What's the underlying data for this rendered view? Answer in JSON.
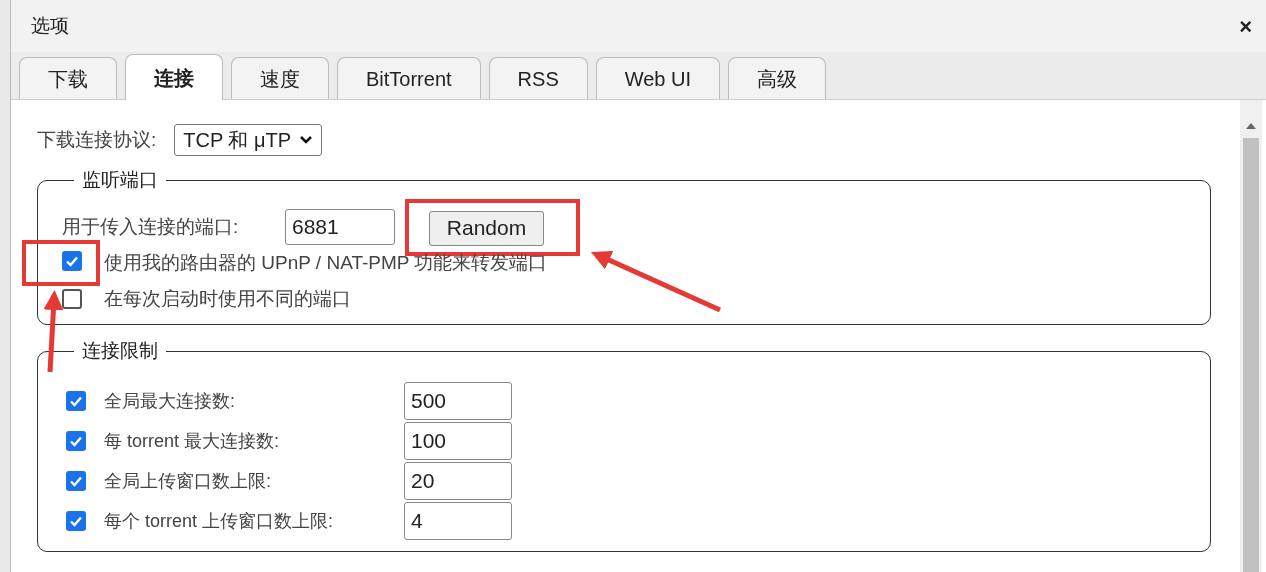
{
  "window": {
    "title": "选项",
    "close": "×"
  },
  "tabs": [
    {
      "label": "下载",
      "selected": false
    },
    {
      "label": "连接",
      "selected": true
    },
    {
      "label": "速度",
      "selected": false
    },
    {
      "label": "BitTorrent",
      "selected": false
    },
    {
      "label": "RSS",
      "selected": false
    },
    {
      "label": "Web UI",
      "selected": false
    },
    {
      "label": "高级",
      "selected": false
    }
  ],
  "protocol": {
    "label": "下载连接协议:",
    "value": "TCP 和 μTP"
  },
  "listening_port": {
    "legend": "监听端口",
    "port_label": "用于传入连接的端口:",
    "port_value": "6881",
    "random_button": "Random",
    "options": [
      {
        "label": "使用我的路由器的 UPnP / NAT-PMP 功能来转发端口",
        "checked": true
      },
      {
        "label": "在每次启动时使用不同的端口",
        "checked": false
      }
    ]
  },
  "connection_limits": {
    "legend": "连接限制",
    "rows": [
      {
        "label": "全局最大连接数:",
        "checked": true,
        "value": "500"
      },
      {
        "label": "每 torrent 最大连接数:",
        "checked": true,
        "value": "100"
      },
      {
        "label": "全局上传窗口数上限:",
        "checked": true,
        "value": "20"
      },
      {
        "label": "每个 torrent 上传窗口数上限:",
        "checked": true,
        "value": "4"
      }
    ]
  }
}
